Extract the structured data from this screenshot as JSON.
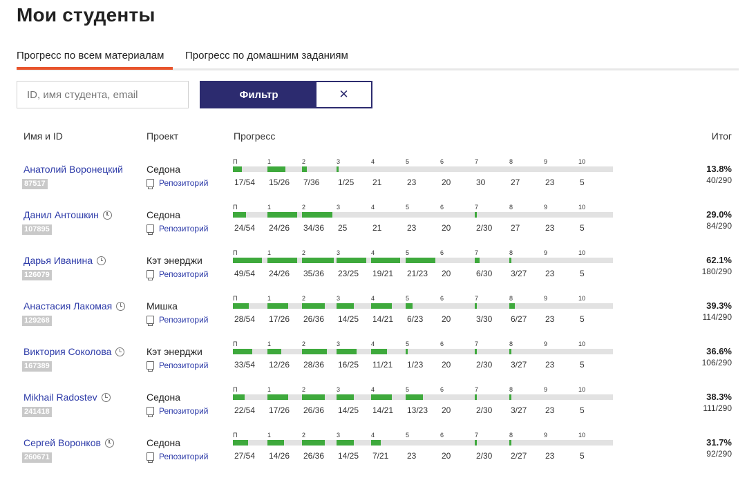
{
  "page": {
    "title": "Мои студенты"
  },
  "tabs": [
    {
      "label": "Прогресс по всем материалам",
      "active": true
    },
    {
      "label": "Прогресс по домашним заданиям",
      "active": false
    }
  ],
  "search": {
    "placeholder": "ID, имя студента, email",
    "value": ""
  },
  "filter": {
    "label": "Фильтр",
    "clear_label": "✕"
  },
  "table": {
    "headers": {
      "name": "Имя и ID",
      "project": "Проект",
      "progress": "Прогресс",
      "total": "Итог"
    },
    "segment_labels": [
      "П",
      "1",
      "2",
      "3",
      "4",
      "5",
      "6",
      "7",
      "8",
      "9",
      "10"
    ],
    "repo_label": "Репозиторий",
    "rows": [
      {
        "name": "Анатолий Воронецкий",
        "id": "87517",
        "clock": false,
        "project": "Седона",
        "progress": [
          {
            "text": "17/54",
            "fill": 0.3148
          },
          {
            "text": "15/26",
            "fill": 0.5769
          },
          {
            "text": "7/36",
            "fill": 0.1944
          },
          {
            "text": "1/25",
            "fill": 0.04
          },
          {
            "text": "21",
            "fill": 0
          },
          {
            "text": "23",
            "fill": 0
          },
          {
            "text": "20",
            "fill": 0
          },
          {
            "text": "30",
            "fill": 0
          },
          {
            "text": "27",
            "fill": 0
          },
          {
            "text": "23",
            "fill": 0
          },
          {
            "text": "5",
            "fill": 0
          }
        ],
        "total_pct": "13.8%",
        "total_count": "40/290"
      },
      {
        "name": "Данил Антошкин",
        "id": "107895",
        "clock": true,
        "project": "Седона",
        "progress": [
          {
            "text": "24/54",
            "fill": 0.4444
          },
          {
            "text": "24/26",
            "fill": 0.9231
          },
          {
            "text": "34/36",
            "fill": 0.9444
          },
          {
            "text": "25",
            "fill": 0
          },
          {
            "text": "21",
            "fill": 0
          },
          {
            "text": "23",
            "fill": 0
          },
          {
            "text": "20",
            "fill": 0
          },
          {
            "text": "2/30",
            "fill": 0.0667
          },
          {
            "text": "27",
            "fill": 0
          },
          {
            "text": "23",
            "fill": 0
          },
          {
            "text": "5",
            "fill": 0
          }
        ],
        "total_pct": "29.0%",
        "total_count": "84/290"
      },
      {
        "name": "Дарья Иванина",
        "id": "126079",
        "clock": true,
        "project": "Кэт энерджи",
        "progress": [
          {
            "text": "49/54",
            "fill": 0.9074
          },
          {
            "text": "24/26",
            "fill": 0.9231
          },
          {
            "text": "35/36",
            "fill": 0.9722
          },
          {
            "text": "23/25",
            "fill": 0.92
          },
          {
            "text": "19/21",
            "fill": 0.9048
          },
          {
            "text": "21/23",
            "fill": 0.913
          },
          {
            "text": "20",
            "fill": 0
          },
          {
            "text": "6/30",
            "fill": 0.2
          },
          {
            "text": "3/27",
            "fill": 0.1111
          },
          {
            "text": "23",
            "fill": 0
          },
          {
            "text": "5",
            "fill": 0
          }
        ],
        "total_pct": "62.1%",
        "total_count": "180/290"
      },
      {
        "name": "Анастасия Лакомая",
        "id": "129268",
        "clock": true,
        "project": "Мишка",
        "progress": [
          {
            "text": "28/54",
            "fill": 0.5185
          },
          {
            "text": "17/26",
            "fill": 0.6538
          },
          {
            "text": "26/36",
            "fill": 0.7222
          },
          {
            "text": "14/25",
            "fill": 0.56
          },
          {
            "text": "14/21",
            "fill": 0.6667
          },
          {
            "text": "6/23",
            "fill": 0.2609
          },
          {
            "text": "20",
            "fill": 0
          },
          {
            "text": "3/30",
            "fill": 0.1
          },
          {
            "text": "6/27",
            "fill": 0.2222
          },
          {
            "text": "23",
            "fill": 0
          },
          {
            "text": "5",
            "fill": 0
          }
        ],
        "total_pct": "39.3%",
        "total_count": "114/290"
      },
      {
        "name": "Виктория Соколова",
        "id": "167389",
        "clock": true,
        "project": "Кэт энерджи",
        "progress": [
          {
            "text": "33/54",
            "fill": 0.6111
          },
          {
            "text": "12/26",
            "fill": 0.4615
          },
          {
            "text": "28/36",
            "fill": 0.7778
          },
          {
            "text": "16/25",
            "fill": 0.64
          },
          {
            "text": "11/21",
            "fill": 0.5238
          },
          {
            "text": "1/23",
            "fill": 0.0435
          },
          {
            "text": "20",
            "fill": 0
          },
          {
            "text": "2/30",
            "fill": 0.0667
          },
          {
            "text": "3/27",
            "fill": 0.1111
          },
          {
            "text": "23",
            "fill": 0
          },
          {
            "text": "5",
            "fill": 0
          }
        ],
        "total_pct": "36.6%",
        "total_count": "106/290"
      },
      {
        "name": "Mikhail Radostev",
        "id": "241418",
        "clock": true,
        "project": "Седона",
        "progress": [
          {
            "text": "22/54",
            "fill": 0.4074
          },
          {
            "text": "17/26",
            "fill": 0.6538
          },
          {
            "text": "26/36",
            "fill": 0.7222
          },
          {
            "text": "14/25",
            "fill": 0.56
          },
          {
            "text": "14/21",
            "fill": 0.6667
          },
          {
            "text": "13/23",
            "fill": 0.5652
          },
          {
            "text": "20",
            "fill": 0
          },
          {
            "text": "2/30",
            "fill": 0.0667
          },
          {
            "text": "3/27",
            "fill": 0.1111
          },
          {
            "text": "23",
            "fill": 0
          },
          {
            "text": "5",
            "fill": 0
          }
        ],
        "total_pct": "38.3%",
        "total_count": "111/290"
      },
      {
        "name": "Сергей Воронков",
        "id": "260671",
        "clock": true,
        "project": "Седона",
        "progress": [
          {
            "text": "27/54",
            "fill": 0.5
          },
          {
            "text": "14/26",
            "fill": 0.5385
          },
          {
            "text": "26/36",
            "fill": 0.7222
          },
          {
            "text": "14/25",
            "fill": 0.56
          },
          {
            "text": "7/21",
            "fill": 0.3333
          },
          {
            "text": "23",
            "fill": 0
          },
          {
            "text": "20",
            "fill": 0
          },
          {
            "text": "2/30",
            "fill": 0.0667
          },
          {
            "text": "2/27",
            "fill": 0.0741
          },
          {
            "text": "23",
            "fill": 0
          },
          {
            "text": "5",
            "fill": 0
          }
        ],
        "total_pct": "31.7%",
        "total_count": "92/290"
      }
    ]
  }
}
